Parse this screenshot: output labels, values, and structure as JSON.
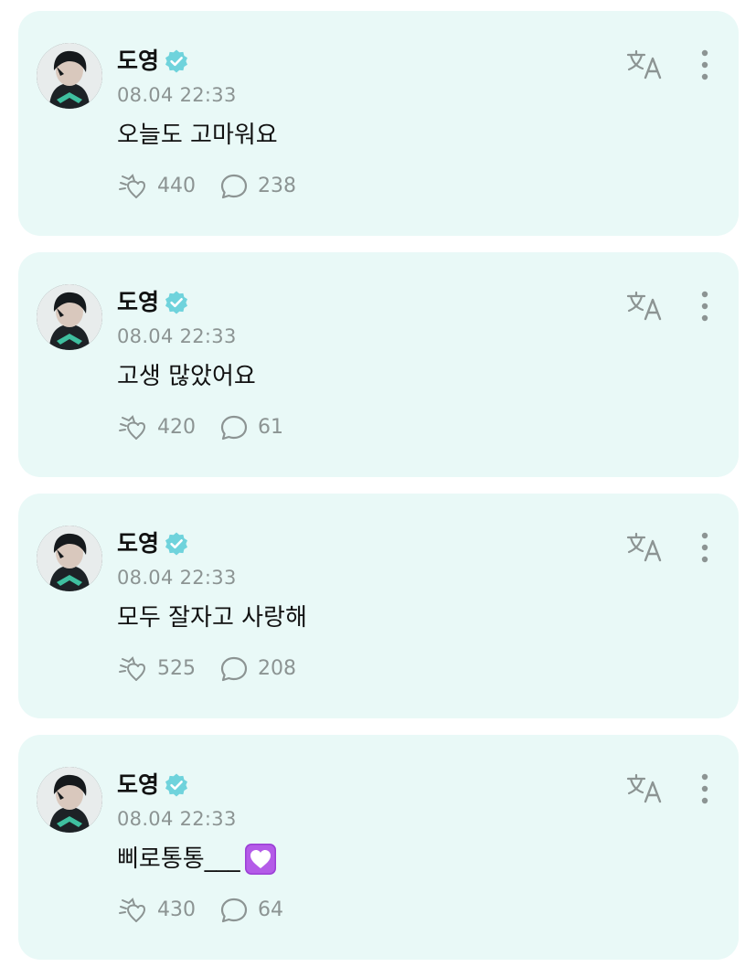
{
  "colors": {
    "card_background": "#e9f9f7",
    "verified_badge": "#6fd3dc",
    "muted_text": "#8c9493",
    "primary_text": "#111111"
  },
  "posts": [
    {
      "author": "도영",
      "verified": true,
      "timestamp": "08.04 22:33",
      "text": "오늘도 고마워요",
      "emoji": null,
      "likes": "440",
      "comments": "238",
      "icons": [
        "avatar",
        "verified-badge-icon",
        "translate-icon",
        "more-vertical-icon",
        "like-icon",
        "comment-icon"
      ]
    },
    {
      "author": "도영",
      "verified": true,
      "timestamp": "08.04 22:33",
      "text": "고생 많았어요",
      "emoji": null,
      "likes": "420",
      "comments": "61",
      "icons": [
        "avatar",
        "verified-badge-icon",
        "translate-icon",
        "more-vertical-icon",
        "like-icon",
        "comment-icon"
      ]
    },
    {
      "author": "도영",
      "verified": true,
      "timestamp": "08.04 22:33",
      "text": "모두 잘자고 사랑해",
      "emoji": null,
      "likes": "525",
      "comments": "208",
      "icons": [
        "avatar",
        "verified-badge-icon",
        "translate-icon",
        "more-vertical-icon",
        "like-icon",
        "comment-icon"
      ]
    },
    {
      "author": "도영",
      "verified": true,
      "timestamp": "08.04 22:33",
      "text": "삐로통통___",
      "emoji": "heart-emoji",
      "likes": "430",
      "comments": "64",
      "icons": [
        "avatar",
        "verified-badge-icon",
        "translate-icon",
        "more-vertical-icon",
        "like-icon",
        "comment-icon",
        "heart-emoji"
      ]
    }
  ]
}
